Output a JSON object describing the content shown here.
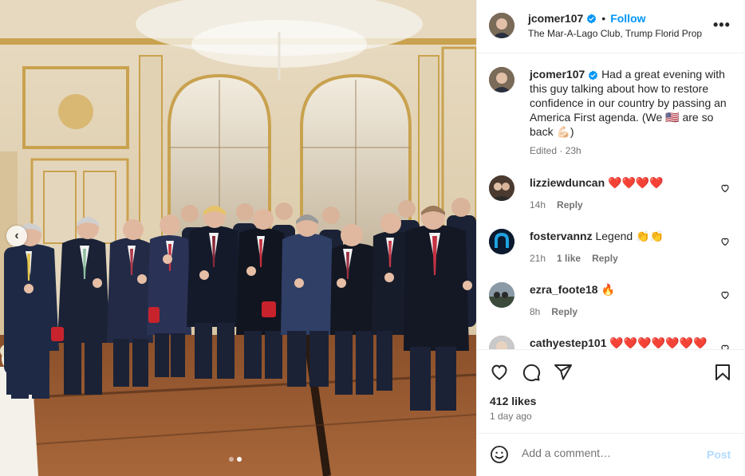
{
  "post": {
    "username": "jcomer107",
    "follow_label": "Follow",
    "separator": "•",
    "location": "The Mar-A-Lago Club, Trump Florid Prop",
    "more_label": "•••",
    "caption": "Had a great evening with this guy talking about how to restore confidence in our country by passing an America First agenda. (We 🇺🇸 are so back 💪🏻)",
    "caption_meta": "Edited · 23h"
  },
  "comments": [
    {
      "username": "lizziewduncan",
      "text": "❤️❤️❤️❤️",
      "time": "14h",
      "likes": "",
      "reply": "Reply"
    },
    {
      "username": "fostervannz",
      "text": "Legend 👏👏",
      "time": "21h",
      "likes": "1 like",
      "reply": "Reply"
    },
    {
      "username": "ezra_foote18",
      "text": "🔥",
      "time": "8h",
      "likes": "",
      "reply": "Reply"
    },
    {
      "username": "cathyestep101",
      "text": "❤️❤️❤️❤️❤️❤️❤️",
      "time": "",
      "likes": "",
      "reply": ""
    }
  ],
  "actions": {
    "likes_label": "412 likes",
    "time_ago": "1 day ago"
  },
  "composer": {
    "placeholder": "Add a comment…",
    "post_label": "Post"
  },
  "carousel": {
    "prev_label": "‹",
    "total_slides": 2,
    "active_slide": 2
  },
  "icons": [
    "chevron-left-icon",
    "verified-badge-icon",
    "more-icon",
    "heart-icon",
    "comment-icon",
    "share-icon",
    "bookmark-icon",
    "emoji-icon"
  ],
  "colors": {
    "accent": "#0095f6",
    "post_disabled": "#b3dbff",
    "muted": "#737373",
    "like_red": "#ed4956"
  }
}
